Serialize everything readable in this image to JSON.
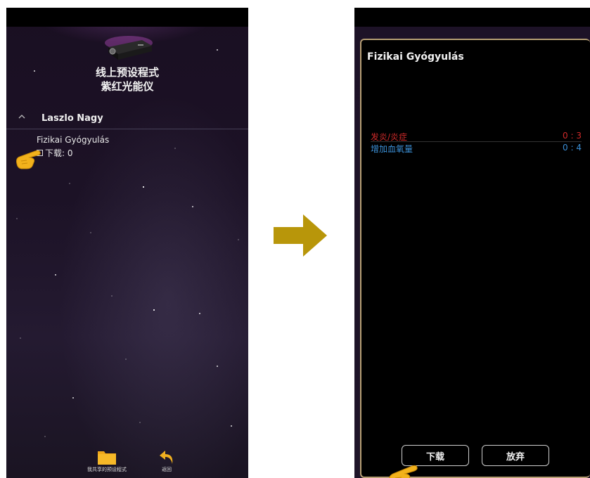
{
  "left_screen": {
    "app_title_line1": "线上预设程式",
    "app_title_line2": "紫红光能仪",
    "group_name": "Laszlo Nagy",
    "program_name": "Fizikai Gyógyulás",
    "download_label": "下载: 0",
    "bottom_nav": {
      "my_shared_label": "我共享的预设程式",
      "back_label": "返回"
    },
    "icons": [
      "projector-icon",
      "chevron-up-icon",
      "checkbox-icon",
      "hand-pointer-icon",
      "folder-icon",
      "undo-arrow-icon"
    ]
  },
  "arrow": {
    "color": "#b8960a",
    "icon": "arrow-right-icon"
  },
  "right_screen": {
    "dialog_title": "Fizikai Gyógyulás",
    "items": [
      {
        "name": "发炎/炎症",
        "time": "0 : 3",
        "color": "#d02a2a"
      },
      {
        "name": "增加血氧量",
        "time": "0 : 4",
        "color": "#3b8fd6"
      }
    ],
    "download_button": "下载",
    "abandon_button": "放弃",
    "dialog_border_color": "#b79f74"
  }
}
